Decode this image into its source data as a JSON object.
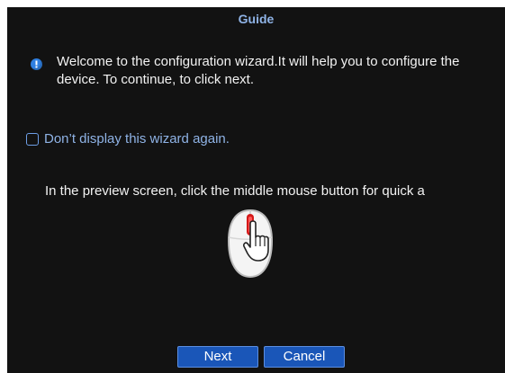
{
  "dialog": {
    "title": "Guide",
    "info_icon": "info-icon",
    "welcome_text": "Welcome to the configuration wizard.It will help you to configure the device. To continue, to click next.",
    "dont_show_label": "Don’t display this wizard again.",
    "dont_show_checked": false,
    "hint_text": "In the preview screen, click the middle mouse button for quick a",
    "mouse_icon": "mouse-click-icon",
    "next_label": "Next",
    "cancel_label": "Cancel"
  },
  "colors": {
    "background": "#121212",
    "title": "#8fb3e6",
    "text": "#f2f2f2",
    "checkbox_label": "#8fb3e6",
    "button": "#1a56b8",
    "icon": "#2f7fe0"
  }
}
